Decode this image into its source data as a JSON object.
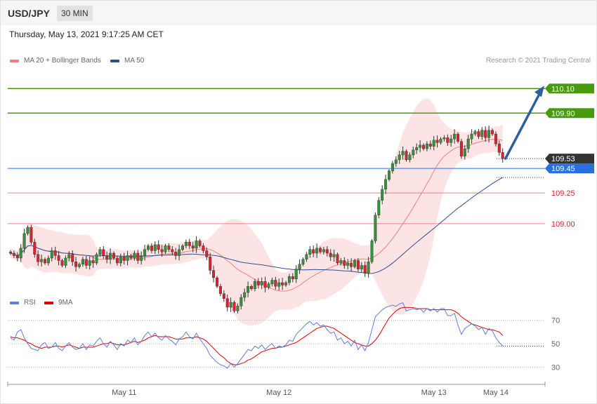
{
  "header": {
    "symbol": "USD/JPY",
    "timeframe": "30 MIN"
  },
  "date_text": "Thursday, May 13, 2021 9:17:25 AM CET",
  "legend_main": [
    {
      "label": "MA 20 + Bollinger Bands",
      "color": "#f08080"
    },
    {
      "label": "MA 50",
      "color": "#2e4f8f"
    }
  ],
  "legend_rsi": [
    {
      "label": "RSI",
      "color": "#5b7fdb"
    },
    {
      "label": "9MA",
      "color": "#e00000"
    }
  ],
  "credit": "Research © 2021 Trading Central",
  "colors": {
    "up": "#3a8f3a",
    "down": "#d9232e",
    "target": "#4a9a0e",
    "pivot": "#2a6fe0",
    "support": "#f08080",
    "arrow": "#2e5da0"
  },
  "chart_data": [
    {
      "type": "candlestick",
      "ylim": [
        108.48,
        110.25
      ],
      "x_ticks": [
        "May 11",
        "May 12",
        "May 13",
        "May 14"
      ],
      "levels": [
        {
          "label": "110.10",
          "value": 110.1,
          "kind": "target"
        },
        {
          "label": "109.90",
          "value": 109.9,
          "kind": "target"
        },
        {
          "label": "109.53",
          "value": 109.53,
          "kind": "last"
        },
        {
          "label": "109.45",
          "value": 109.45,
          "kind": "pivot"
        },
        {
          "label": "109.25",
          "value": 109.25,
          "kind": "support"
        },
        {
          "label": "109.00",
          "value": 109.0,
          "kind": "support"
        }
      ],
      "arrow": {
        "from": 109.53,
        "to": 110.1
      },
      "close": [
        108.76,
        108.74,
        108.72,
        108.8,
        108.92,
        108.97,
        108.85,
        108.75,
        108.69,
        108.71,
        108.68,
        108.72,
        108.78,
        108.74,
        108.7,
        108.66,
        108.72,
        108.75,
        108.69,
        108.65,
        108.67,
        108.71,
        108.66,
        108.7,
        108.68,
        108.75,
        108.79,
        108.74,
        108.71,
        108.76,
        108.72,
        108.68,
        108.73,
        108.7,
        108.74,
        108.72,
        108.76,
        108.7,
        108.74,
        108.79,
        108.82,
        108.78,
        108.83,
        108.79,
        108.77,
        108.82,
        108.79,
        108.77,
        108.74,
        108.79,
        108.82,
        108.85,
        108.82,
        108.8,
        108.86,
        108.82,
        108.78,
        108.73,
        108.62,
        108.56,
        108.49,
        108.43,
        108.39,
        108.32,
        108.36,
        108.29,
        108.33,
        108.4,
        108.44,
        108.49,
        108.47,
        108.53,
        108.5,
        108.53,
        108.48,
        108.51,
        108.54,
        108.49,
        108.52,
        108.5,
        108.52,
        108.57,
        108.55,
        108.63,
        108.67,
        108.71,
        108.75,
        108.79,
        108.76,
        108.8,
        108.77,
        108.79,
        108.76,
        108.73,
        108.75,
        108.68,
        108.7,
        108.66,
        108.68,
        108.65,
        108.7,
        108.63,
        108.66,
        108.6,
        108.69,
        108.86,
        109.07,
        109.19,
        109.28,
        109.36,
        109.43,
        109.49,
        109.52,
        109.56,
        109.59,
        109.52,
        109.56,
        109.6,
        109.62,
        109.64,
        109.61,
        109.65,
        109.63,
        109.68,
        109.66,
        109.69,
        109.7,
        109.66,
        109.69,
        109.73,
        109.67,
        109.55,
        109.61,
        109.69,
        109.73,
        109.75,
        109.71,
        109.76,
        109.7,
        109.76,
        109.73,
        109.65,
        109.58,
        109.53
      ],
      "rsi": {
        "ylim": [
          20,
          80
        ],
        "ticks": [
          "70",
          "50",
          "30"
        ],
        "rsi_values": [
          55,
          53,
          60,
          62,
          55,
          50,
          46,
          45,
          44,
          49,
          51,
          46,
          47,
          51,
          46,
          44,
          48,
          51,
          47,
          45,
          46,
          50,
          45,
          49,
          48,
          52,
          55,
          50,
          47,
          52,
          49,
          45,
          50,
          48,
          53,
          51,
          55,
          49,
          52,
          57,
          60,
          56,
          59,
          55,
          53,
          57,
          54,
          52,
          49,
          54,
          56,
          60,
          56,
          54,
          59,
          54,
          50,
          46,
          40,
          37,
          34,
          32,
          31,
          29,
          33,
          30,
          33,
          37,
          41,
          45,
          44,
          48,
          46,
          49,
          45,
          48,
          50,
          46,
          48,
          47,
          49,
          53,
          52,
          58,
          61,
          64,
          67,
          69,
          66,
          68,
          65,
          66,
          62,
          59,
          60,
          53,
          55,
          50,
          52,
          48,
          53,
          45,
          49,
          44,
          51,
          62,
          73,
          76,
          79,
          81,
          82,
          83,
          82,
          84,
          85,
          78,
          79,
          80,
          79,
          80,
          77,
          80,
          78,
          80,
          77,
          80,
          80,
          74,
          74,
          76,
          66,
          58,
          63,
          65,
          67,
          65,
          62,
          64,
          58,
          63,
          61,
          55,
          51,
          48
        ],
        "ma_values": [
          56,
          55,
          55,
          54,
          53,
          51,
          50,
          48,
          47,
          46,
          47,
          47,
          47,
          48,
          48,
          47,
          48,
          49,
          48,
          47,
          46,
          47,
          47,
          47,
          47,
          48,
          49,
          50,
          50,
          51,
          50,
          49,
          49,
          49,
          50,
          51,
          52,
          51,
          52,
          53,
          55,
          56,
          57,
          56,
          56,
          56,
          56,
          55,
          54,
          54,
          54,
          55,
          55,
          55,
          56,
          55,
          54,
          52,
          49,
          46,
          43,
          40,
          38,
          35,
          33,
          32,
          32,
          33,
          34,
          36,
          37,
          39,
          41,
          43,
          44,
          45,
          46,
          46,
          47,
          47,
          48,
          49,
          50,
          51,
          53,
          55,
          57,
          59,
          61,
          63,
          64,
          65,
          65,
          64,
          63,
          61,
          59,
          57,
          55,
          53,
          51,
          50,
          49,
          48,
          48,
          50,
          53,
          57,
          62,
          67,
          72,
          75,
          78,
          80,
          81,
          81,
          81,
          81,
          80,
          80,
          80,
          80,
          79,
          79,
          79,
          79,
          79,
          79,
          79,
          78,
          76,
          73,
          71,
          69,
          67,
          66,
          65,
          64,
          63,
          62,
          62,
          61,
          60,
          57
        ]
      }
    }
  ]
}
